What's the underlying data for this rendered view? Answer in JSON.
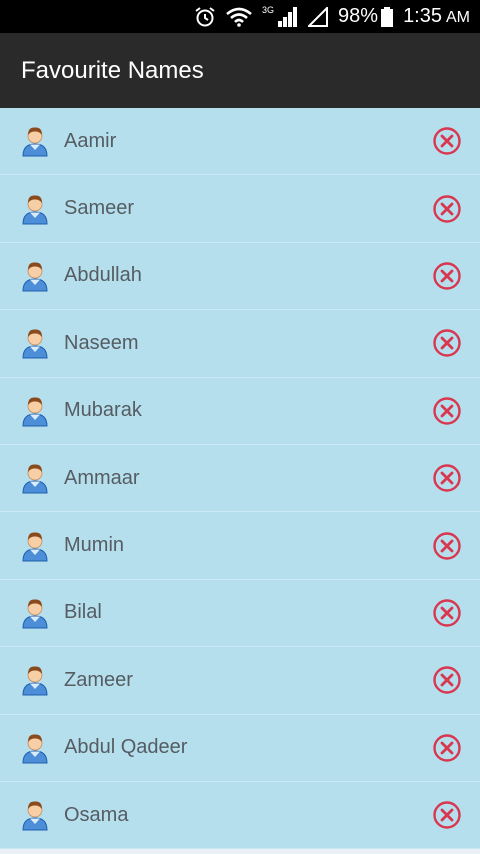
{
  "status_bar": {
    "network_label": "3G",
    "battery": "98%",
    "time": "1:35",
    "ampm": "AM"
  },
  "app_bar": {
    "title": "Favourite Names"
  },
  "names": [
    "Aamir",
    "Sameer",
    "Abdullah",
    "Naseem",
    "Mubarak",
    "Ammaar",
    "Mumin",
    "Bilal",
    "Zameer",
    "Abdul Qadeer",
    "Osama"
  ],
  "icons": {
    "avatar": "user-avatar-icon",
    "remove": "remove-circle-x-icon"
  },
  "colors": {
    "list_background": "#b6dfee",
    "app_bar": "#2a2a2a",
    "remove_icon": "#d9364f"
  }
}
